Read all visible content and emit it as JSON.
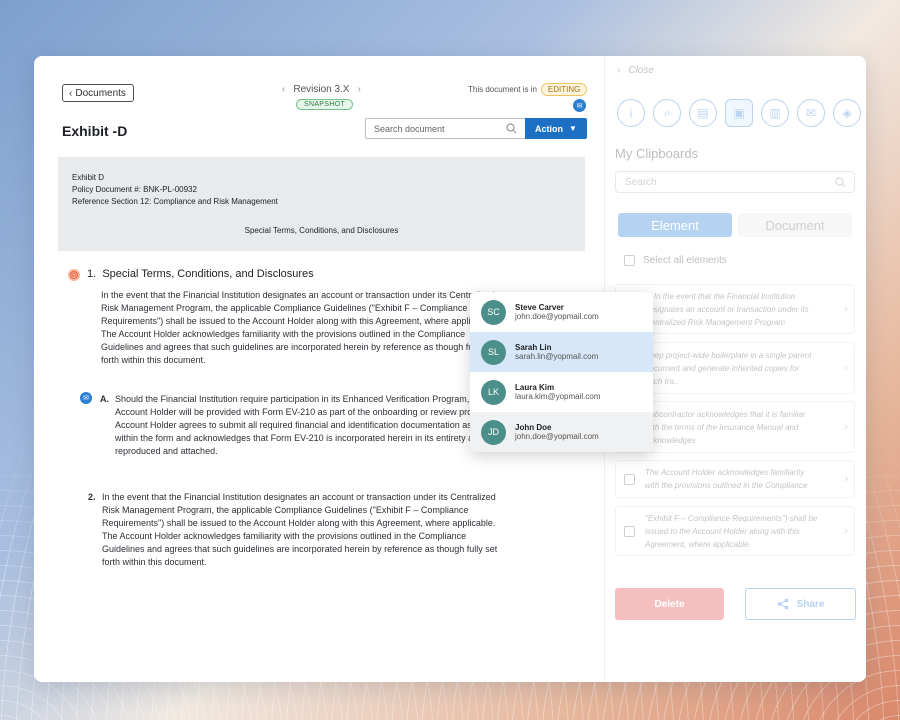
{
  "header": {
    "back_label": "Documents",
    "title": "Exhibit -D",
    "revision": "Revision 3.X",
    "snapshot": "SNAPSHOT",
    "status_prefix": "This document is in",
    "status_badge": "EDITING",
    "search_placeholder": "Search document",
    "action_label": "Action"
  },
  "doc_header": {
    "line1": "Exhibit D",
    "line2": "Policy Document #: BNK-PL-00932",
    "line3": "Reference Section 12: Compliance and Risk Management",
    "center": "Special Terms, Conditions, and Disclosures"
  },
  "sections": [
    {
      "number": "1.",
      "title": "Special Terms, Conditions, and Disclosures",
      "lines": [
        "In the event that the Financial Institution designates an account or transaction under its Centralized",
        "Risk Management Program, the applicable Compliance Guidelines (\"Exhibit F – Compliance",
        "Requirements\") shall be issued to the Account Holder along with this Agreement, where applicable.",
        "The Account Holder acknowledges familiarity with the provisions outlined in the Compliance",
        "Guidelines and agrees that such guidelines are incorporated herein by reference as though fully set",
        "forth within this document."
      ]
    },
    {
      "number": "A.",
      "lines": [
        "Should the Financial Institution require participation in its Enhanced Verification Program, the",
        "Account Holder will be provided with Form EV-210 as part of the onboarding or review process. The",
        "Account Holder agrees to submit all required financial and identification documentation as specified",
        "within the form and acknowledges that Form EV-210 is incorporated herein in its entirety as if fully",
        "reproduced and attached."
      ]
    },
    {
      "number": "2.",
      "lines": [
        "In the event that the Financial Institution designates an account or transaction under its Centralized",
        "Risk Management Program, the applicable Compliance Guidelines (\"Exhibit F – Compliance",
        "Requirements\") shall be issued to the Account Holder along with this Agreement, where applicable.",
        "The Account Holder acknowledges familiarity with the provisions outlined in the Compliance",
        "Guidelines and agrees that such guidelines are incorporated herein by reference as though fully set",
        "forth within this document."
      ]
    }
  ],
  "users": [
    {
      "initials": "SC",
      "name": "Steve Carver",
      "email": "john.doe@yopmail.com"
    },
    {
      "initials": "SL",
      "name": "Sarah Lin",
      "email": "sarah.lin@yopmail.com"
    },
    {
      "initials": "LK",
      "name": "Laura Kim",
      "email": "laura.kim@yopmail.com"
    },
    {
      "initials": "JD",
      "name": "John Doe",
      "email": "john.doe@yopmail.com"
    }
  ],
  "panel": {
    "close_label": "Close",
    "title": "My Clipboards",
    "search_placeholder": "Search",
    "tab_element": "Element",
    "tab_document": "Document",
    "select_all": "Select all elements",
    "cards": [
      {
        "line1": "1. In the event that the Financial Institution",
        "line2": "designates an account or transaction under its",
        "line3": "Centralized Risk Management Program"
      },
      {
        "line1": "Keep project-wide boilerplate in a single parent",
        "line2": "document and generate inherited copies for",
        "line3": "each tra.."
      },
      {
        "line1": "Subcontractor acknowledges that it is familiar",
        "line2": "with the terms of the Insurance Manual and",
        "line3": "acknowledges"
      },
      {
        "line1": "The Account Holder acknowledges familiarity",
        "line2": "with the provisions outlined in the Compliance",
        "line3": ""
      },
      {
        "line1": "\"Exhibit F – Compliance Requirements\") shall be",
        "line2": "issued to the Account Holder along with this",
        "line3": "Agreement, where applicable."
      }
    ],
    "delete_label": "Delete",
    "share_label": "Share"
  }
}
